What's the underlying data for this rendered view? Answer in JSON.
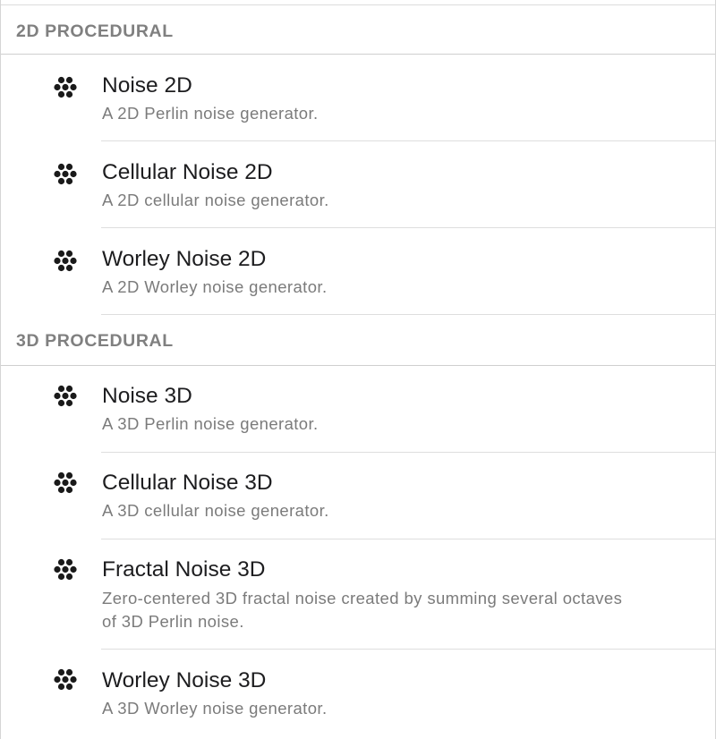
{
  "sections": [
    {
      "title": "2D PROCEDURAL",
      "items": [
        {
          "name": "Noise 2D",
          "description": "A 2D Perlin noise generator.",
          "icon": "noise-dots-icon"
        },
        {
          "name": "Cellular Noise 2D",
          "description": "A 2D cellular noise generator.",
          "icon": "noise-dots-icon"
        },
        {
          "name": "Worley Noise 2D",
          "description": "A 2D Worley noise generator.",
          "icon": "noise-dots-icon"
        }
      ]
    },
    {
      "title": "3D PROCEDURAL",
      "items": [
        {
          "name": "Noise 3D",
          "description": "A 3D Perlin noise generator.",
          "icon": "noise-dots-icon"
        },
        {
          "name": "Cellular Noise 3D",
          "description": "A 3D cellular noise generator.",
          "icon": "noise-dots-icon"
        },
        {
          "name": "Fractal Noise 3D",
          "description": "Zero-centered 3D fractal noise created by summing several octaves of 3D Perlin noise.",
          "icon": "noise-dots-icon"
        },
        {
          "name": "Worley Noise 3D",
          "description": "A 3D Worley noise generator.",
          "icon": "noise-dots-icon"
        }
      ]
    }
  ],
  "colors": {
    "header_text": "#808080",
    "title_text": "#1d1d1f",
    "description_text": "#7b7b7b",
    "divider": "#dedede",
    "icon": "#1a1a1a"
  }
}
